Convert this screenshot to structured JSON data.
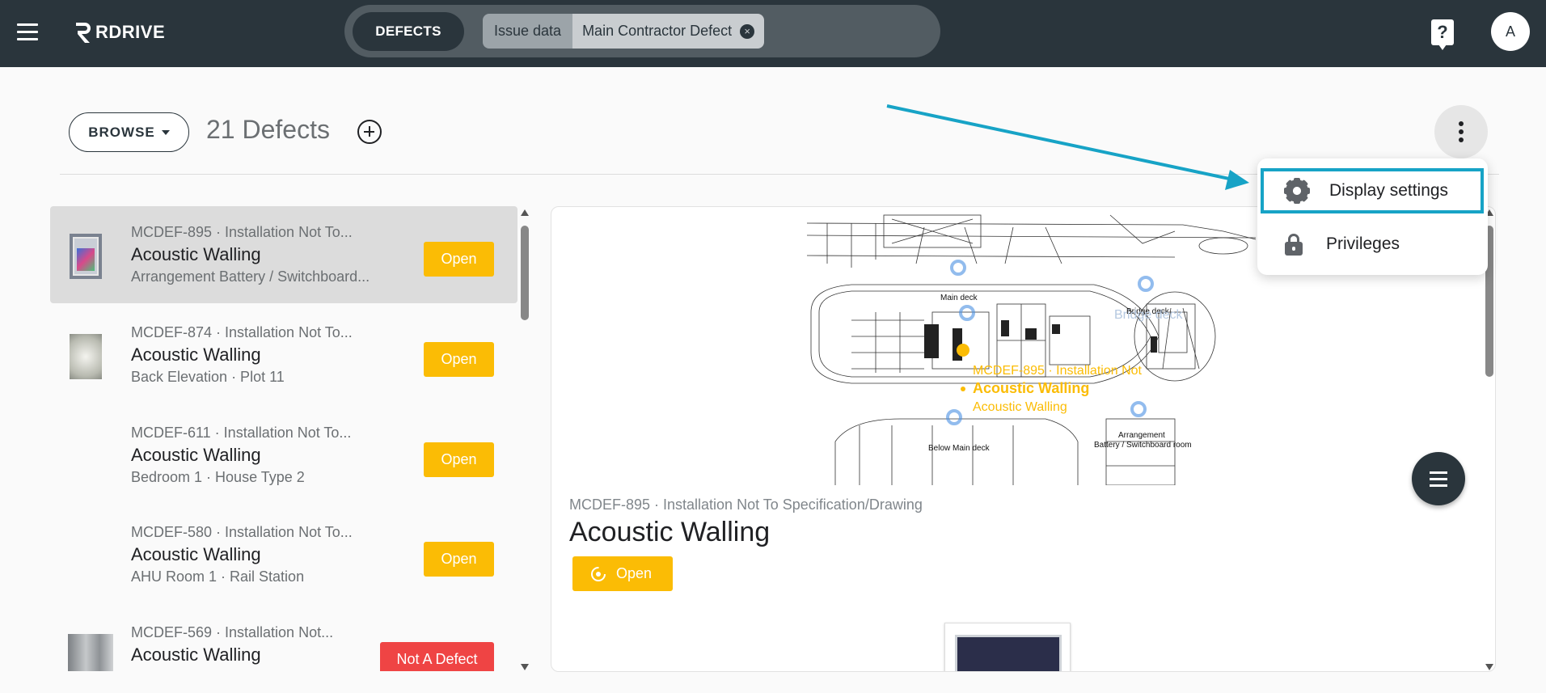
{
  "header": {
    "logo_text": "RDRIVE",
    "tab_label": "DEFECTS",
    "filter_chip": {
      "key": "Issue data",
      "value": "Main Contractor Defect"
    },
    "help_icon": "help-icon",
    "avatar_initial": "A"
  },
  "toolbar": {
    "browse_label": "BROWSE",
    "count_title": "21 Defects"
  },
  "menu": {
    "items": [
      {
        "label": "Display settings",
        "icon": "gear-icon"
      },
      {
        "label": "Privileges",
        "icon": "lock-icon"
      }
    ]
  },
  "defects": [
    {
      "code": "MCDEF-895 · Installation Not To...",
      "title": "Acoustic Walling",
      "location": "Arrangement Battery / Switchboard...",
      "status": "Open"
    },
    {
      "code": "MCDEF-874 · Installation Not To...",
      "title": "Acoustic Walling",
      "location": "Back Elevation · Plot 11",
      "status": "Open"
    },
    {
      "code": "MCDEF-611 · Installation Not To...",
      "title": "Acoustic Walling",
      "location": "Bedroom 1 · House Type 2",
      "status": "Open"
    },
    {
      "code": "MCDEF-580 · Installation Not To...",
      "title": "Acoustic Walling",
      "location": "AHU Room 1 · Rail Station",
      "status": "Open"
    },
    {
      "code": "MCDEF-569 · Installation Not...",
      "title": "Acoustic Walling",
      "location": "",
      "status": "Not A Defect"
    }
  ],
  "detail": {
    "code": "MCDEF-895 · Installation Not To Specification/Drawing",
    "title": "Acoustic Walling",
    "status": "Open",
    "drawing": {
      "labels": [
        "Main deck",
        "Bridge deck",
        "Below Main deck",
        "Arrangement",
        "Battery / Switchboard room"
      ],
      "ghost_label": "Bridge deck",
      "pin_code": "MCDEF-895 · Installation Not",
      "pin_title": "Acoustic Walling",
      "pin_sub": "Acoustic Walling"
    }
  },
  "colors": {
    "topbar": "#2a353c",
    "open": "#fbbc05",
    "not_a_defect": "#ef4444",
    "highlight": "#17a3c6"
  }
}
